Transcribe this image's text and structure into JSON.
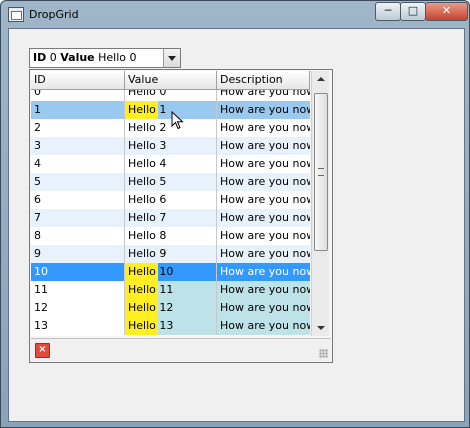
{
  "window": {
    "title": "DropGrid",
    "min_label": "─",
    "max_label": "□",
    "close_label": "✕"
  },
  "combo": {
    "id_label": "ID",
    "id_value": "0",
    "value_label": "Value",
    "value_value": "Hello 0"
  },
  "grid": {
    "columns": [
      "ID",
      "Value",
      "Description"
    ],
    "rows": [
      {
        "id": "0",
        "value": "Hello 0",
        "desc": "How are you now?"
      },
      {
        "id": "1",
        "value": "Hello 1",
        "desc": "How are you now?"
      },
      {
        "id": "2",
        "value": "Hello 2",
        "desc": "How are you now?"
      },
      {
        "id": "3",
        "value": "Hello 3",
        "desc": "How are you now?"
      },
      {
        "id": "4",
        "value": "Hello 4",
        "desc": "How are you now?"
      },
      {
        "id": "5",
        "value": "Hello 5",
        "desc": "How are you now?"
      },
      {
        "id": "6",
        "value": "Hello 6",
        "desc": "How are you now?"
      },
      {
        "id": "7",
        "value": "Hello 7",
        "desc": "How are you now?"
      },
      {
        "id": "8",
        "value": "Hello 8",
        "desc": "How are you now?"
      },
      {
        "id": "9",
        "value": "Hello 9",
        "desc": "How are you now?"
      },
      {
        "id": "10",
        "value": "Hello 10",
        "desc": "How are you now?"
      },
      {
        "id": "11",
        "value": "Hello 11",
        "desc": "How are you now?"
      },
      {
        "id": "12",
        "value": "Hello 12",
        "desc": "How are you now?"
      },
      {
        "id": "13",
        "value": "Hello 13",
        "desc": "How are you now?"
      }
    ]
  },
  "colors": {
    "hover": "#99c9ef",
    "selected": "#3399ff",
    "highlight": "#ffee22",
    "match": "#bde3e8"
  },
  "icons": {
    "clear": "clear-icon",
    "resize": "resize-grip-icon",
    "cursor": "mouse-cursor-icon"
  }
}
